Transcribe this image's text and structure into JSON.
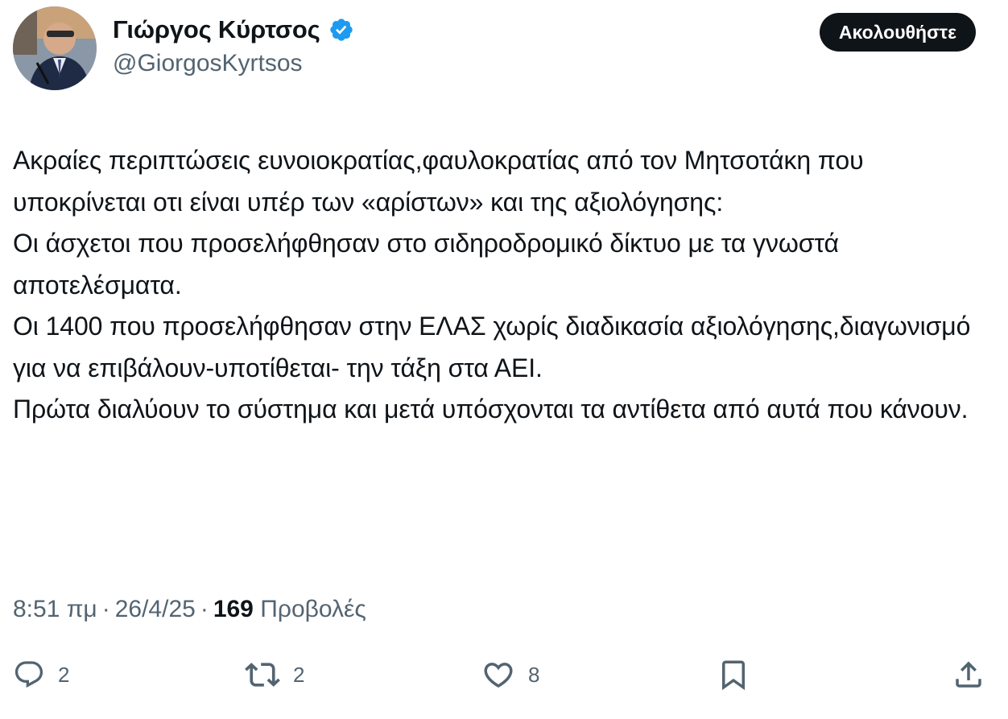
{
  "author": {
    "display_name": "Γιώργος Κύρτσος",
    "handle": "@GiorgosKyrtsos",
    "verified_icon": "verified-badge-icon",
    "verified_color": "#1d9bf0"
  },
  "follow_button": {
    "label": "Ακολουθήστε"
  },
  "tweet": {
    "paragraphs": [
      "Ακραίες περιπτώσεις ευνοιοκρατίας,φαυλοκρατίας από τον Μητσοτάκη που υποκρίνεται οτι είναι υπέρ των «αρίστων» και της αξιολόγησης:",
      "Οι άσχετοι που προσελήφθησαν στο σιδηροδρομικό δίκτυο με τα γνωστά αποτελέσματα.",
      "Οι 1400 που προσελήφθησαν στην ΕΛΑΣ χωρίς διαδικασία αξιολόγησης,διαγωνισμό για να επιβάλουν-υποτίθεται- την τάξη στα ΑΕΙ.",
      "Πρώτα διαλύουν το σύστημα και μετά υπόσχονται τα αντίθετα από αυτά που κάνουν."
    ]
  },
  "meta": {
    "time": "8:51 πμ",
    "date": "26/4/25",
    "views_count": "169",
    "views_label": "Προβολές",
    "separator": "·"
  },
  "actions": {
    "reply": {
      "icon": "reply-icon",
      "count": "2"
    },
    "retweet": {
      "icon": "retweet-icon",
      "count": "2"
    },
    "like": {
      "icon": "heart-icon",
      "count": "8"
    },
    "bookmark": {
      "icon": "bookmark-icon"
    },
    "share": {
      "icon": "share-icon"
    }
  },
  "colors": {
    "text": "#0f1419",
    "secondary": "#536471",
    "button_bg": "#0f1419",
    "button_text": "#ffffff"
  }
}
